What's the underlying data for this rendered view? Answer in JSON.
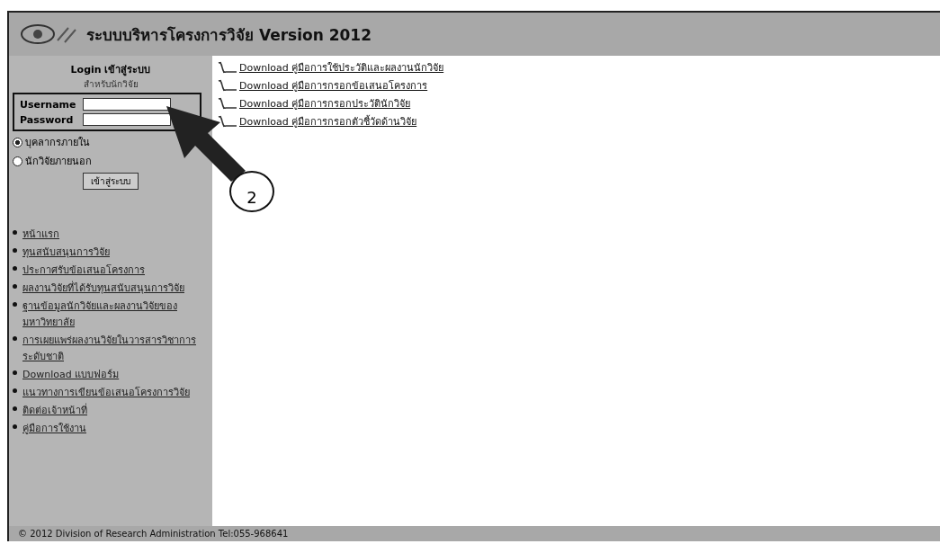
{
  "header": {
    "title": "ระบบบริหารโครงการวิจัย Version 2012"
  },
  "login": {
    "heading": "Login เข้าสู่ระบบ",
    "subheading": "สำหรับนักวิจัย",
    "username_label": "Username",
    "password_label": "Password",
    "user_types": [
      {
        "label": "บุคลากรภายใน",
        "selected": true
      },
      {
        "label": "นักวิจัยภายนอก",
        "selected": false
      }
    ],
    "button": "เข้าสู่ระบบ"
  },
  "menu": [
    "หน้าแรก",
    "ทุนสนับสนุนการวิจัย",
    "ประกาศรับข้อเสนอโครงการ",
    "ผลงานวิจัยที่ได้รับทุนสนับสนุนการวิจัย",
    "ฐานข้อมูลนักวิจัยและผลงานวิจัยของมหาวิทยาลัย",
    "การเผยแพร่ผลงานวิจัยในวารสารวิชาการระดับชาติ",
    "Download แบบฟอร์ม",
    "แนวทางการเขียนข้อเสนอโครงการวิจัย",
    "ติดต่อเจ้าหน้าที่",
    "คู่มือการใช้งาน"
  ],
  "downloads": [
    "Download คู่มือการใช้ประวัติและผลงานนักวิจัย",
    "Download คู่มือการกรอกข้อเสนอโครงการ",
    "Download คู่มือการกรอกประวัตินักวิจัย",
    "Download คู่มือการกรอกตัวชี้วัดด้านวิจัย"
  ],
  "annotation": {
    "label": "2"
  },
  "footer": "© 2012 Division of Research Administration Tel:055-968641"
}
